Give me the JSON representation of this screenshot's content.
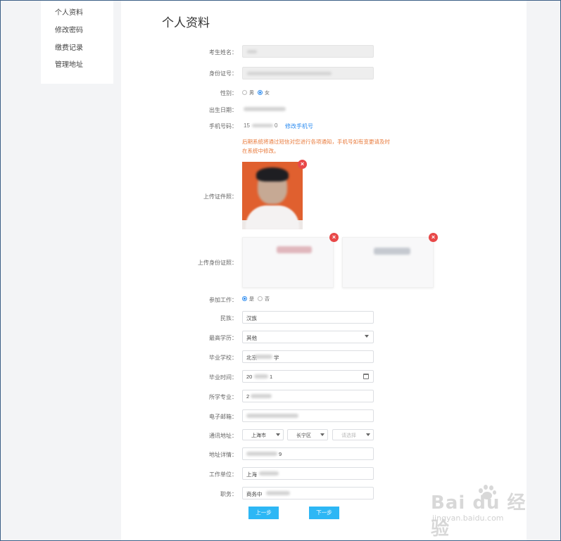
{
  "sidebar": {
    "items": [
      "个人资料",
      "修改密码",
      "缴费记录",
      "管理地址"
    ]
  },
  "page": {
    "title": "个人资料"
  },
  "form": {
    "name_label": "考生姓名：",
    "idnum_label": "身份证号：",
    "gender": {
      "label": "性别：",
      "options": [
        "男",
        "女"
      ],
      "selected": "女"
    },
    "birth_label": "出生日期：",
    "phone": {
      "label": "手机号码：",
      "prefix": "15",
      "suffix": "0",
      "change_link": "修改手机号"
    },
    "notice": "后期系统将通过短信对您进行各项通知，手机号如有变更请及时在系统中修改。",
    "photo_label": "上传证件照：",
    "idcard_label": "上传身份证照：",
    "work": {
      "label": "参加工作：",
      "options": [
        "是",
        "否"
      ],
      "selected": "是"
    },
    "ethnicity": {
      "label": "民族：",
      "value": "汉族"
    },
    "education": {
      "label": "最高学历：",
      "value": "其他"
    },
    "school": {
      "label": "毕业学校：",
      "prefix": "北京",
      "suffix": "学"
    },
    "grad_time": {
      "label": "毕业时间：",
      "prefix": "20",
      "suffix": "1"
    },
    "major": {
      "label": "所学专业：",
      "prefix": "2"
    },
    "email_label": "电子邮箱：",
    "address": {
      "label": "通讯地址：",
      "province": "上海市",
      "district": "长宁区",
      "placeholder": "请选择"
    },
    "address_detail": {
      "label": "地址详情：",
      "suffix": "9"
    },
    "employer": {
      "label": "工作单位：",
      "prefix": "上海"
    },
    "position": {
      "label": "职务：",
      "prefix": "商务中"
    }
  },
  "buttons": {
    "prev": "上一步",
    "next": "下一步"
  },
  "watermark": {
    "main": "Bai du 经验",
    "sub": "jingyan.baidu.com"
  },
  "colors": {
    "accent": "#2d8cf0",
    "button": "#2db7f5",
    "notice": "#e8793a",
    "delete": "#e84848"
  }
}
